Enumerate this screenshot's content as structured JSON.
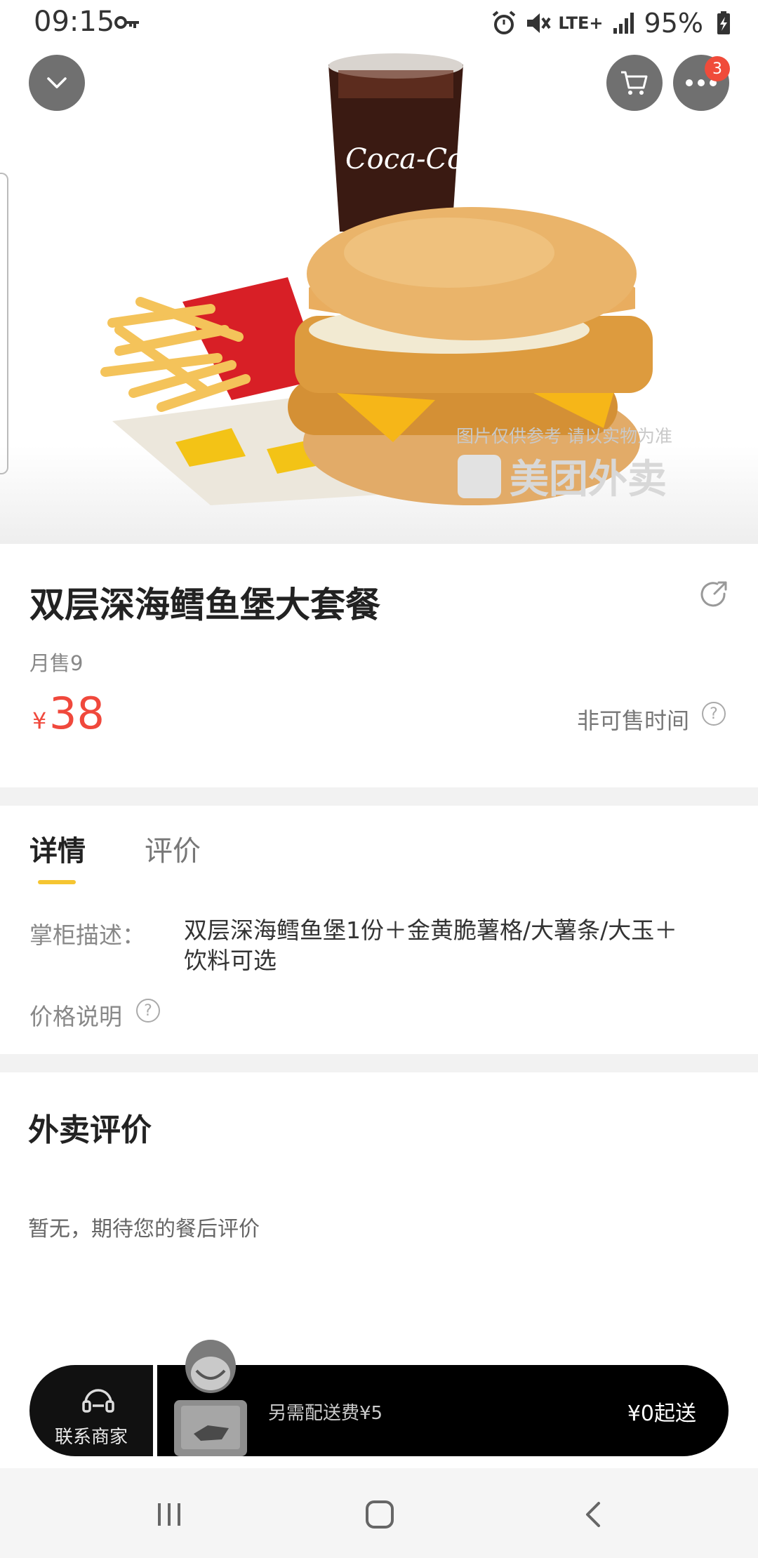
{
  "status_bar": {
    "time": "09:15",
    "network": "LTE+",
    "battery": "95%",
    "icons": [
      "key-icon",
      "alarm-icon",
      "mute-icon",
      "signal-icon",
      "battery-icon"
    ]
  },
  "hero": {
    "image": "food-photo",
    "watermark_note": "图片仅供参考 请以实物为准",
    "watermark_brand": "美团外卖",
    "more_badge_count": "3"
  },
  "product": {
    "name": "双层深海鳕鱼堡大套餐",
    "monthly_sales": "月售9",
    "price_symbol": "¥",
    "price": "38",
    "unavailable_time": "非可售时间"
  },
  "tabs": [
    {
      "label": "详情",
      "active": true
    },
    {
      "label": "评价",
      "active": false
    }
  ],
  "details": {
    "desc_label": "掌柜描述：",
    "desc_text": "双层深海鳕鱼堡1份＋金黄脆薯格/大薯条/大玉＋饮料可选",
    "price_note_label": "价格说明"
  },
  "reviews": {
    "title": "外卖评价",
    "empty_text": "暂无，期待您的餐后评价"
  },
  "bottom_bar": {
    "contact_label": "联系商家",
    "delivery_fee": "另需配送费¥5",
    "min_order": "¥0起送"
  },
  "colors": {
    "price": "#f0483c",
    "tab_underline": "#f5c531",
    "badge": "#f04b3a",
    "bar_bg": "#000000"
  }
}
